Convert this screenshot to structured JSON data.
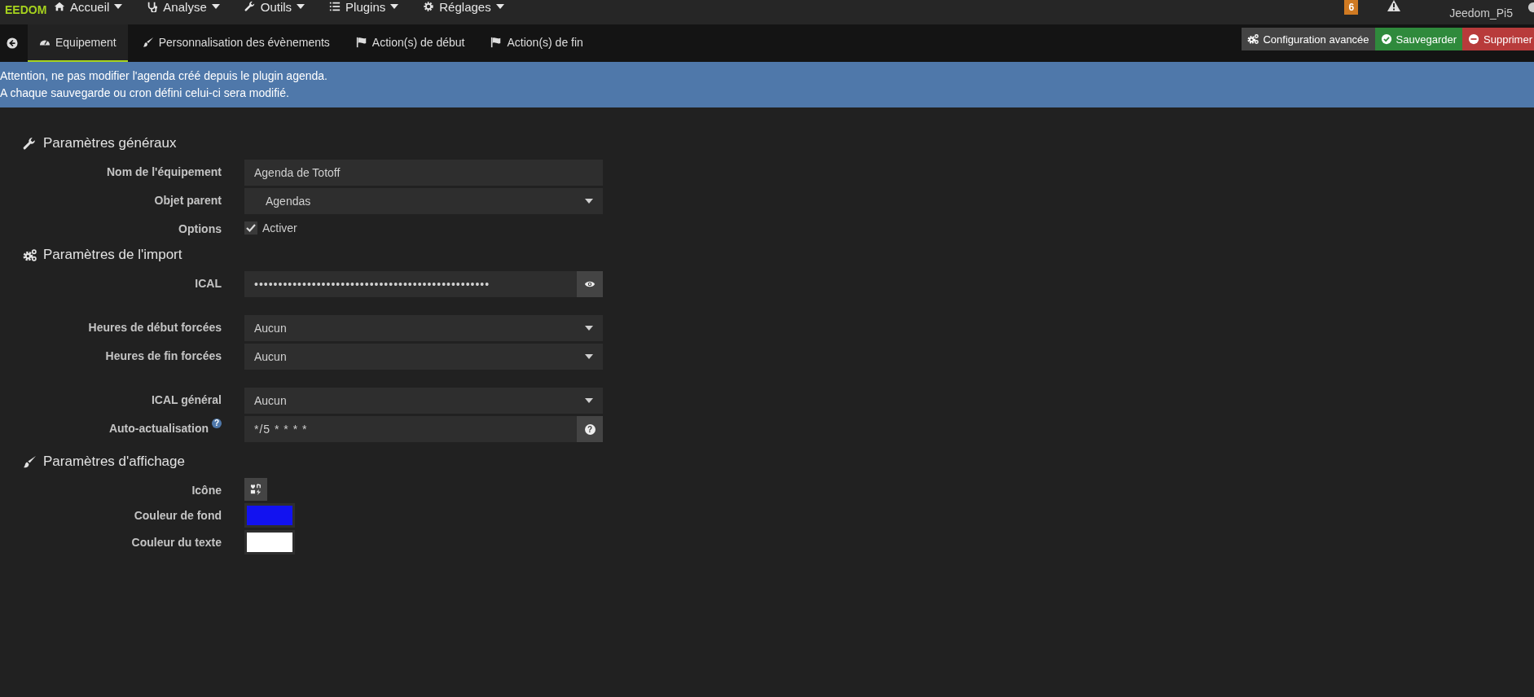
{
  "navbar": {
    "logo": "EEDOM",
    "menus": [
      {
        "label": "Accueil"
      },
      {
        "label": "Analyse"
      },
      {
        "label": "Outils"
      },
      {
        "label": "Plugins"
      },
      {
        "label": "Réglages"
      }
    ],
    "badge": "6",
    "hostname": "Jeedom_Pi5"
  },
  "tabs": [
    {
      "label": "Equipement",
      "selected": true
    },
    {
      "label": "Personnalisation des évènements",
      "selected": false
    },
    {
      "label": "Action(s) de début",
      "selected": false
    },
    {
      "label": "Action(s) de fin",
      "selected": false
    }
  ],
  "actions": [
    {
      "label": "Configuration avancée",
      "kind": "config"
    },
    {
      "label": "Sauvegarder",
      "kind": "save"
    },
    {
      "label": "Supprimer",
      "kind": "delete"
    }
  ],
  "alert": [
    "Attention, ne pas modifier l'agenda créé depuis le plugin agenda.",
    "A chaque sauvegarde ou cron défini celui-ci sera modifié."
  ],
  "sections": [
    {
      "title": "Paramètres généraux",
      "groups": [
        [
          {
            "label": "Nom de l'équipement",
            "kind": "text",
            "value": "Agenda de Totoff"
          },
          {
            "label": "Objet parent",
            "kind": "select",
            "value": "Agendas"
          },
          {
            "label": "Options",
            "kind": "checkbox",
            "text": "Activer",
            "checked": true
          }
        ]
      ]
    },
    {
      "title": "Paramètres de l'import",
      "groups": [
        [
          {
            "label": "ICAL",
            "kind": "password",
            "value": "•••••••••••••••••••••••••••••••••••••••••••••••••"
          }
        ],
        [
          {
            "label": "Heures de début forcées",
            "kind": "select",
            "value": "Aucun"
          },
          {
            "label": "Heures de fin forcées",
            "kind": "select",
            "value": "Aucun"
          }
        ],
        [
          {
            "label": "ICAL général",
            "kind": "select",
            "value": "Aucun"
          },
          {
            "label": "Auto-actualisation",
            "kind": "cron",
            "value": "*/5 * * * *",
            "help_icon": "?",
            "addon": "?"
          }
        ]
      ]
    },
    {
      "title": "Paramètres d'affichage",
      "groups": [
        [
          {
            "label": "Icône",
            "kind": "icon"
          },
          {
            "label": "Couleur de fond",
            "kind": "color",
            "color": "#1212f0"
          },
          {
            "label": "Couleur du texte",
            "kind": "color",
            "color": "#ffffff"
          }
        ]
      ]
    }
  ]
}
